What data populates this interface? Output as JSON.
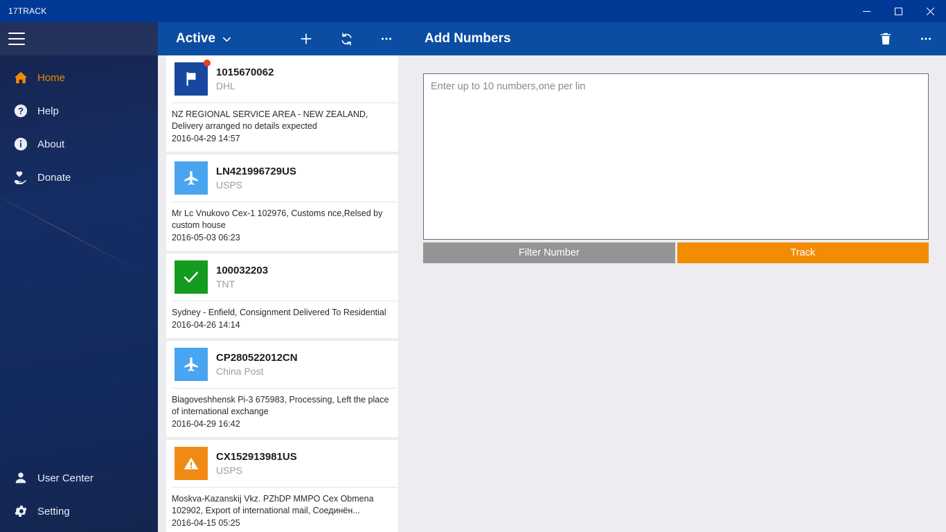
{
  "window": {
    "app_title": "17TRACK",
    "controls": {
      "minimize": "minimize-button",
      "maximize": "maximize-button",
      "close": "close-button"
    }
  },
  "sidebar": {
    "menu_icon": "hamburger-icon",
    "items": [
      {
        "label": "Home",
        "icon": "home-icon",
        "active": true
      },
      {
        "label": "Help",
        "icon": "help-circle-icon",
        "active": false
      },
      {
        "label": "About",
        "icon": "info-circle-icon",
        "active": false
      },
      {
        "label": "Donate",
        "icon": "hand-heart-icon",
        "active": false
      }
    ],
    "bottom_items": [
      {
        "label": "User Center",
        "icon": "person-icon"
      },
      {
        "label": "Setting",
        "icon": "gear-icon"
      }
    ]
  },
  "list_panel": {
    "filter_label": "Active",
    "filter_caret": "chevron-down-icon",
    "actions": [
      {
        "name": "add-button",
        "icon": "plus-icon"
      },
      {
        "name": "refresh-button",
        "icon": "refresh-icon"
      },
      {
        "name": "more-button",
        "icon": "ellipsis-icon"
      }
    ],
    "items": [
      {
        "number": "1015670062",
        "carrier": "DHL",
        "status_icon": "flag-icon",
        "tile_color": "#17479E",
        "has_badge": true,
        "description": "NZ REGIONAL SERVICE AREA - NEW ZEALAND, Delivery arranged no details expected",
        "date": "2016-04-29 14:57"
      },
      {
        "number": "LN421996729US",
        "carrier": "USPS",
        "status_icon": "airplane-icon",
        "tile_color": "#49A5F0",
        "has_badge": false,
        "description": "Mr Lc Vnukovo Cex-1 102976, Customs nce,Relsed by custom house",
        "date": "2016-05-03 06:23"
      },
      {
        "number": "100032203",
        "carrier": "TNT",
        "status_icon": "check-icon",
        "tile_color": "#139C1E",
        "has_badge": false,
        "description": "Sydney - Enfield, Consignment Delivered To Residential",
        "date": "2016-04-26 14:14"
      },
      {
        "number": "CP280522012CN",
        "carrier": "China Post",
        "status_icon": "airplane-icon",
        "tile_color": "#49A5F0",
        "has_badge": false,
        "description": "Blagoveshhensk Pi-3 675983, Processing, Left the place of international exchange",
        "date": "2016-04-29 16:42"
      },
      {
        "number": "CX152913981US",
        "carrier": "USPS",
        "status_icon": "warning-triangle-icon",
        "tile_color": "#F08A14",
        "has_badge": false,
        "description": "Moskva-Kazanskij Vkz. PZhDP MMPO Cex Obmena 102902, Export of international mail, Соединён...",
        "date": "2016-04-15 05:25"
      }
    ]
  },
  "detail_panel": {
    "title": "Add Numbers",
    "actions": [
      {
        "name": "delete-button",
        "icon": "trash-icon"
      },
      {
        "name": "more-button",
        "icon": "ellipsis-icon"
      }
    ],
    "input": {
      "value": "",
      "placeholder": "Enter up to 10 numbers,one per lin"
    },
    "filter_button_label": "Filter Number",
    "track_button_label": "Track"
  },
  "colors": {
    "titlebar": "#003A96",
    "header_blue": "#0A4DA2",
    "accent_orange": "#F28C00",
    "active_nav": "#F08A00",
    "page_bg": "#ECECF1",
    "badge_red": "#E8401C"
  }
}
